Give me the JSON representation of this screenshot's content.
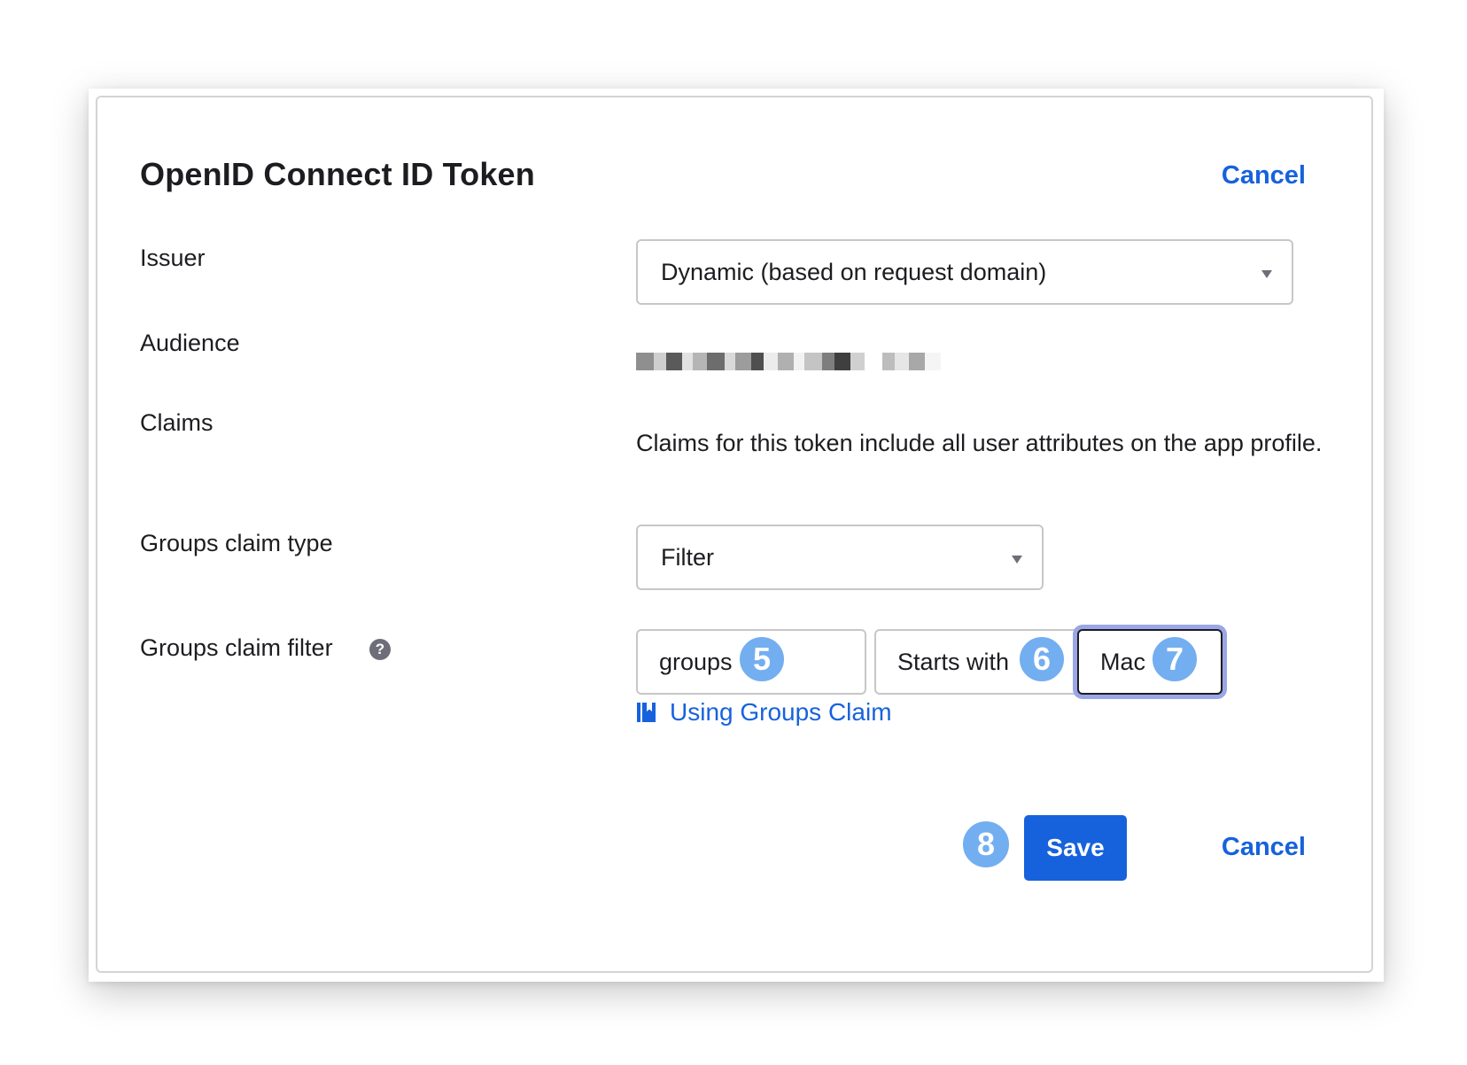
{
  "dialog": {
    "title": "OpenID Connect ID Token",
    "cancel_top_label": "Cancel"
  },
  "issuer": {
    "label": "Issuer",
    "selected_value": "Dynamic (based on request domain)"
  },
  "audience": {
    "label": "Audience"
  },
  "claims": {
    "label": "Claims",
    "description": "Claims for this token include all user attributes on the app profile."
  },
  "groups_claim_type": {
    "label": "Groups claim type",
    "selected_value": "Filter"
  },
  "groups_claim_filter": {
    "label": "Groups claim filter",
    "help_icon_glyph": "?",
    "name_value": "groups",
    "operator_value": "Starts with",
    "filter_value": "Mac",
    "doc_link_label": "Using Groups Claim"
  },
  "footer": {
    "save_label": "Save",
    "cancel_label": "Cancel"
  },
  "annotations": {
    "badge_5": "5",
    "badge_6": "6",
    "badge_7": "7",
    "badge_8": "8"
  },
  "colors": {
    "link": "#1662dd",
    "primary_button": "#1662dd",
    "badge": "#73aef0",
    "focus_ring": "#9aa6e6",
    "text": "#1d1d21"
  },
  "icons": {
    "help": "question-circle-icon",
    "doc": "book-icon",
    "dropdown": "caret-down-icon"
  }
}
